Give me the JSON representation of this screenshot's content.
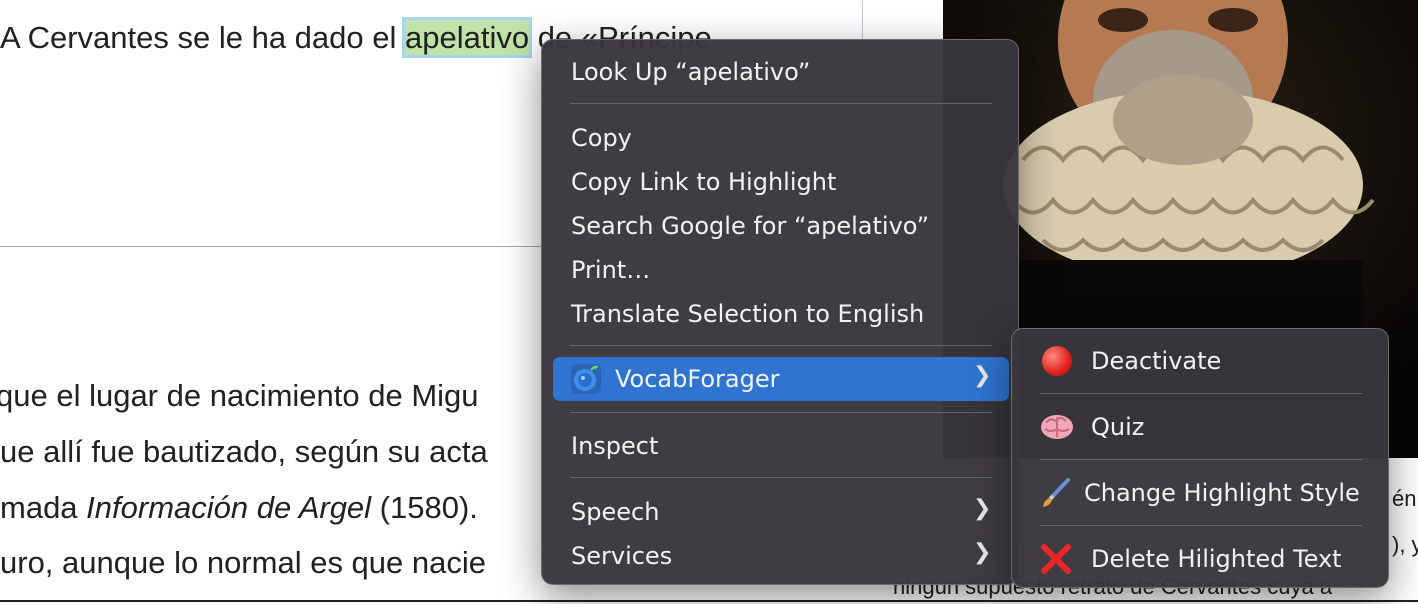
{
  "article": {
    "line1_before": "A Cervantes se le ha dado el ",
    "line1_highlight": "apelativo",
    "line1_after": " de «Príncipe",
    "line2": " que el lugar de nacimiento de Migu",
    "line3": "ue allí fue bautizado, según su acta",
    "line4_before": "madа ",
    "line4_before_fixed": "mada ",
    "line4_italic": "Información de Argel",
    "line4_after": " (1580).",
    "line5": "uro, aunque lo normal es que nacie",
    "caption1": "én",
    "caption2": "), y",
    "caption3": "ningún supuesto retrato de Cervantes cuya a"
  },
  "context_menu": {
    "look_up": "Look Up “apelativo”",
    "copy": "Copy",
    "copy_link": "Copy Link to Highlight",
    "search_google": "Search Google for “apelativo”",
    "print": "Print…",
    "translate": "Translate Selection to English",
    "vocabforager": "VocabForager",
    "inspect": "Inspect",
    "speech": "Speech",
    "services": "Services"
  },
  "submenu": {
    "deactivate": "Deactivate",
    "quiz": "Quiz",
    "change_style": "Change Highlight Style",
    "delete_text": "Delete Hilighted Text"
  },
  "colors": {
    "menu_bg": "#3a373c",
    "highlight_row": "#2f74d0",
    "text_highlight": "#bfe3a8"
  }
}
